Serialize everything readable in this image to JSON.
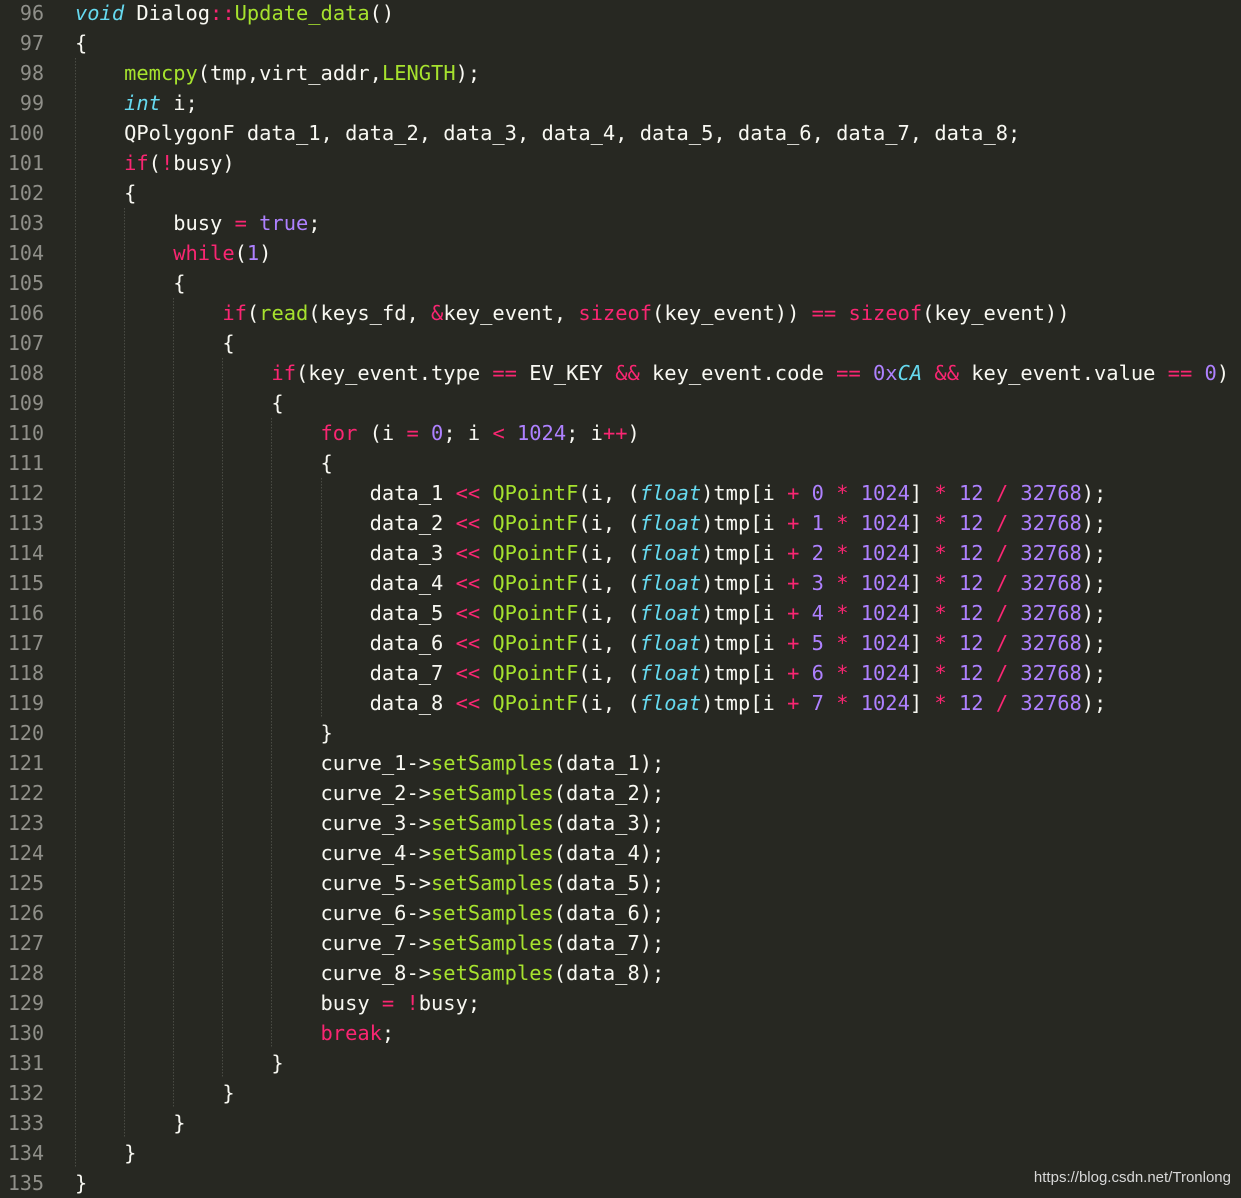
{
  "colors": {
    "background": "#272822",
    "line_number": "#90908a",
    "plain": "#f8f8f2",
    "keyword": "#f92672",
    "function": "#a6e22e",
    "type": "#66d9ef",
    "number": "#ae81ff",
    "indent_guide": "#4a4b44"
  },
  "watermark": "https://blog.csdn.net/Tronlong",
  "lines": [
    {
      "n": "96",
      "tokens": [
        [
          "ty",
          "void"
        ],
        [
          "plain",
          " Dialog"
        ],
        [
          "op",
          "::"
        ],
        [
          "fn",
          "Update_data"
        ],
        [
          "plain",
          "()"
        ]
      ]
    },
    {
      "n": "97",
      "tokens": [
        [
          "plain",
          "{"
        ]
      ]
    },
    {
      "n": "98",
      "tokens": [
        [
          "plain",
          "    "
        ],
        [
          "fn",
          "memcpy"
        ],
        [
          "plain",
          "(tmp,virt_addr,"
        ],
        [
          "fn",
          "LENGTH"
        ],
        [
          "plain",
          ");"
        ]
      ]
    },
    {
      "n": "99",
      "tokens": [
        [
          "plain",
          "    "
        ],
        [
          "ty",
          "int"
        ],
        [
          "plain",
          " i;"
        ]
      ]
    },
    {
      "n": "100",
      "tokens": [
        [
          "plain",
          "    QPolygonF data_1, data_2, data_3, data_4, data_5, data_6, data_7, data_8;"
        ]
      ]
    },
    {
      "n": "101",
      "tokens": [
        [
          "plain",
          "    "
        ],
        [
          "kw",
          "if"
        ],
        [
          "plain",
          "("
        ],
        [
          "op",
          "!"
        ],
        [
          "plain",
          "busy)"
        ]
      ]
    },
    {
      "n": "102",
      "tokens": [
        [
          "plain",
          "    {"
        ]
      ]
    },
    {
      "n": "103",
      "tokens": [
        [
          "plain",
          "        busy "
        ],
        [
          "op",
          "="
        ],
        [
          "plain",
          " "
        ],
        [
          "num",
          "true"
        ],
        [
          "plain",
          ";"
        ]
      ]
    },
    {
      "n": "104",
      "tokens": [
        [
          "plain",
          "        "
        ],
        [
          "kw",
          "while"
        ],
        [
          "plain",
          "("
        ],
        [
          "num",
          "1"
        ],
        [
          "plain",
          ")"
        ]
      ]
    },
    {
      "n": "105",
      "tokens": [
        [
          "plain",
          "        {"
        ]
      ]
    },
    {
      "n": "106",
      "tokens": [
        [
          "plain",
          "            "
        ],
        [
          "kw",
          "if"
        ],
        [
          "plain",
          "("
        ],
        [
          "fn",
          "read"
        ],
        [
          "plain",
          "(keys_fd, "
        ],
        [
          "op",
          "&"
        ],
        [
          "plain",
          "key_event, "
        ],
        [
          "kw",
          "sizeof"
        ],
        [
          "plain",
          "(key_event)) "
        ],
        [
          "op",
          "=="
        ],
        [
          "plain",
          " "
        ],
        [
          "kw",
          "sizeof"
        ],
        [
          "plain",
          "(key_event))"
        ]
      ]
    },
    {
      "n": "107",
      "tokens": [
        [
          "plain",
          "            {"
        ]
      ]
    },
    {
      "n": "108",
      "tokens": [
        [
          "plain",
          "                "
        ],
        [
          "kw",
          "if"
        ],
        [
          "plain",
          "(key_event.type "
        ],
        [
          "op",
          "=="
        ],
        [
          "plain",
          " EV_KEY "
        ],
        [
          "op",
          "&&"
        ],
        [
          "plain",
          " key_event.code "
        ],
        [
          "op",
          "=="
        ],
        [
          "plain",
          " "
        ],
        [
          "num",
          "0x"
        ],
        [
          "ty",
          "CA"
        ],
        [
          "plain",
          " "
        ],
        [
          "op",
          "&&"
        ],
        [
          "plain",
          " key_event.value "
        ],
        [
          "op",
          "=="
        ],
        [
          "plain",
          " "
        ],
        [
          "num",
          "0"
        ],
        [
          "plain",
          ")"
        ]
      ]
    },
    {
      "n": "109",
      "tokens": [
        [
          "plain",
          "                {"
        ]
      ]
    },
    {
      "n": "110",
      "tokens": [
        [
          "plain",
          "                    "
        ],
        [
          "kw",
          "for"
        ],
        [
          "plain",
          " (i "
        ],
        [
          "op",
          "="
        ],
        [
          "plain",
          " "
        ],
        [
          "num",
          "0"
        ],
        [
          "plain",
          "; i "
        ],
        [
          "op",
          "<"
        ],
        [
          "plain",
          " "
        ],
        [
          "num",
          "1024"
        ],
        [
          "plain",
          "; i"
        ],
        [
          "op",
          "++"
        ],
        [
          "plain",
          ")"
        ]
      ]
    },
    {
      "n": "111",
      "tokens": [
        [
          "plain",
          "                    {"
        ]
      ]
    },
    {
      "n": "112",
      "tokens": [
        [
          "plain",
          "                        data_1 "
        ],
        [
          "op",
          "<<"
        ],
        [
          "plain",
          " "
        ],
        [
          "fn",
          "QPointF"
        ],
        [
          "plain",
          "(i, ("
        ],
        [
          "ty",
          "float"
        ],
        [
          "plain",
          ")tmp[i "
        ],
        [
          "op",
          "+"
        ],
        [
          "plain",
          " "
        ],
        [
          "num",
          "0"
        ],
        [
          "plain",
          " "
        ],
        [
          "op",
          "*"
        ],
        [
          "plain",
          " "
        ],
        [
          "num",
          "1024"
        ],
        [
          "plain",
          "] "
        ],
        [
          "op",
          "*"
        ],
        [
          "plain",
          " "
        ],
        [
          "num",
          "12"
        ],
        [
          "plain",
          " "
        ],
        [
          "op",
          "/"
        ],
        [
          "plain",
          " "
        ],
        [
          "num",
          "32768"
        ],
        [
          "plain",
          ");"
        ]
      ]
    },
    {
      "n": "113",
      "tokens": [
        [
          "plain",
          "                        data_2 "
        ],
        [
          "op",
          "<<"
        ],
        [
          "plain",
          " "
        ],
        [
          "fn",
          "QPointF"
        ],
        [
          "plain",
          "(i, ("
        ],
        [
          "ty",
          "float"
        ],
        [
          "plain",
          ")tmp[i "
        ],
        [
          "op",
          "+"
        ],
        [
          "plain",
          " "
        ],
        [
          "num",
          "1"
        ],
        [
          "plain",
          " "
        ],
        [
          "op",
          "*"
        ],
        [
          "plain",
          " "
        ],
        [
          "num",
          "1024"
        ],
        [
          "plain",
          "] "
        ],
        [
          "op",
          "*"
        ],
        [
          "plain",
          " "
        ],
        [
          "num",
          "12"
        ],
        [
          "plain",
          " "
        ],
        [
          "op",
          "/"
        ],
        [
          "plain",
          " "
        ],
        [
          "num",
          "32768"
        ],
        [
          "plain",
          ");"
        ]
      ]
    },
    {
      "n": "114",
      "tokens": [
        [
          "plain",
          "                        data_3 "
        ],
        [
          "op",
          "<<"
        ],
        [
          "plain",
          " "
        ],
        [
          "fn",
          "QPointF"
        ],
        [
          "plain",
          "(i, ("
        ],
        [
          "ty",
          "float"
        ],
        [
          "plain",
          ")tmp[i "
        ],
        [
          "op",
          "+"
        ],
        [
          "plain",
          " "
        ],
        [
          "num",
          "2"
        ],
        [
          "plain",
          " "
        ],
        [
          "op",
          "*"
        ],
        [
          "plain",
          " "
        ],
        [
          "num",
          "1024"
        ],
        [
          "plain",
          "] "
        ],
        [
          "op",
          "*"
        ],
        [
          "plain",
          " "
        ],
        [
          "num",
          "12"
        ],
        [
          "plain",
          " "
        ],
        [
          "op",
          "/"
        ],
        [
          "plain",
          " "
        ],
        [
          "num",
          "32768"
        ],
        [
          "plain",
          ");"
        ]
      ]
    },
    {
      "n": "115",
      "tokens": [
        [
          "plain",
          "                        data_4 "
        ],
        [
          "op",
          "<<"
        ],
        [
          "plain",
          " "
        ],
        [
          "fn",
          "QPointF"
        ],
        [
          "plain",
          "(i, ("
        ],
        [
          "ty",
          "float"
        ],
        [
          "plain",
          ")tmp[i "
        ],
        [
          "op",
          "+"
        ],
        [
          "plain",
          " "
        ],
        [
          "num",
          "3"
        ],
        [
          "plain",
          " "
        ],
        [
          "op",
          "*"
        ],
        [
          "plain",
          " "
        ],
        [
          "num",
          "1024"
        ],
        [
          "plain",
          "] "
        ],
        [
          "op",
          "*"
        ],
        [
          "plain",
          " "
        ],
        [
          "num",
          "12"
        ],
        [
          "plain",
          " "
        ],
        [
          "op",
          "/"
        ],
        [
          "plain",
          " "
        ],
        [
          "num",
          "32768"
        ],
        [
          "plain",
          ");"
        ]
      ]
    },
    {
      "n": "116",
      "tokens": [
        [
          "plain",
          "                        data_5 "
        ],
        [
          "op",
          "<<"
        ],
        [
          "plain",
          " "
        ],
        [
          "fn",
          "QPointF"
        ],
        [
          "plain",
          "(i, ("
        ],
        [
          "ty",
          "float"
        ],
        [
          "plain",
          ")tmp[i "
        ],
        [
          "op",
          "+"
        ],
        [
          "plain",
          " "
        ],
        [
          "num",
          "4"
        ],
        [
          "plain",
          " "
        ],
        [
          "op",
          "*"
        ],
        [
          "plain",
          " "
        ],
        [
          "num",
          "1024"
        ],
        [
          "plain",
          "] "
        ],
        [
          "op",
          "*"
        ],
        [
          "plain",
          " "
        ],
        [
          "num",
          "12"
        ],
        [
          "plain",
          " "
        ],
        [
          "op",
          "/"
        ],
        [
          "plain",
          " "
        ],
        [
          "num",
          "32768"
        ],
        [
          "plain",
          ");"
        ]
      ]
    },
    {
      "n": "117",
      "tokens": [
        [
          "plain",
          "                        data_6 "
        ],
        [
          "op",
          "<<"
        ],
        [
          "plain",
          " "
        ],
        [
          "fn",
          "QPointF"
        ],
        [
          "plain",
          "(i, ("
        ],
        [
          "ty",
          "float"
        ],
        [
          "plain",
          ")tmp[i "
        ],
        [
          "op",
          "+"
        ],
        [
          "plain",
          " "
        ],
        [
          "num",
          "5"
        ],
        [
          "plain",
          " "
        ],
        [
          "op",
          "*"
        ],
        [
          "plain",
          " "
        ],
        [
          "num",
          "1024"
        ],
        [
          "plain",
          "] "
        ],
        [
          "op",
          "*"
        ],
        [
          "plain",
          " "
        ],
        [
          "num",
          "12"
        ],
        [
          "plain",
          " "
        ],
        [
          "op",
          "/"
        ],
        [
          "plain",
          " "
        ],
        [
          "num",
          "32768"
        ],
        [
          "plain",
          ");"
        ]
      ]
    },
    {
      "n": "118",
      "tokens": [
        [
          "plain",
          "                        data_7 "
        ],
        [
          "op",
          "<<"
        ],
        [
          "plain",
          " "
        ],
        [
          "fn",
          "QPointF"
        ],
        [
          "plain",
          "(i, ("
        ],
        [
          "ty",
          "float"
        ],
        [
          "plain",
          ")tmp[i "
        ],
        [
          "op",
          "+"
        ],
        [
          "plain",
          " "
        ],
        [
          "num",
          "6"
        ],
        [
          "plain",
          " "
        ],
        [
          "op",
          "*"
        ],
        [
          "plain",
          " "
        ],
        [
          "num",
          "1024"
        ],
        [
          "plain",
          "] "
        ],
        [
          "op",
          "*"
        ],
        [
          "plain",
          " "
        ],
        [
          "num",
          "12"
        ],
        [
          "plain",
          " "
        ],
        [
          "op",
          "/"
        ],
        [
          "plain",
          " "
        ],
        [
          "num",
          "32768"
        ],
        [
          "plain",
          ");"
        ]
      ]
    },
    {
      "n": "119",
      "tokens": [
        [
          "plain",
          "                        data_8 "
        ],
        [
          "op",
          "<<"
        ],
        [
          "plain",
          " "
        ],
        [
          "fn",
          "QPointF"
        ],
        [
          "plain",
          "(i, ("
        ],
        [
          "ty",
          "float"
        ],
        [
          "plain",
          ")tmp[i "
        ],
        [
          "op",
          "+"
        ],
        [
          "plain",
          " "
        ],
        [
          "num",
          "7"
        ],
        [
          "plain",
          " "
        ],
        [
          "op",
          "*"
        ],
        [
          "plain",
          " "
        ],
        [
          "num",
          "1024"
        ],
        [
          "plain",
          "] "
        ],
        [
          "op",
          "*"
        ],
        [
          "plain",
          " "
        ],
        [
          "num",
          "12"
        ],
        [
          "plain",
          " "
        ],
        [
          "op",
          "/"
        ],
        [
          "plain",
          " "
        ],
        [
          "num",
          "32768"
        ],
        [
          "plain",
          ");"
        ]
      ]
    },
    {
      "n": "120",
      "tokens": [
        [
          "plain",
          "                    }"
        ]
      ]
    },
    {
      "n": "121",
      "tokens": [
        [
          "plain",
          "                    curve_1->"
        ],
        [
          "fn",
          "setSamples"
        ],
        [
          "plain",
          "(data_1);"
        ]
      ]
    },
    {
      "n": "122",
      "tokens": [
        [
          "plain",
          "                    curve_2->"
        ],
        [
          "fn",
          "setSamples"
        ],
        [
          "plain",
          "(data_2);"
        ]
      ]
    },
    {
      "n": "123",
      "tokens": [
        [
          "plain",
          "                    curve_3->"
        ],
        [
          "fn",
          "setSamples"
        ],
        [
          "plain",
          "(data_3);"
        ]
      ]
    },
    {
      "n": "124",
      "tokens": [
        [
          "plain",
          "                    curve_4->"
        ],
        [
          "fn",
          "setSamples"
        ],
        [
          "plain",
          "(data_4);"
        ]
      ]
    },
    {
      "n": "125",
      "tokens": [
        [
          "plain",
          "                    curve_5->"
        ],
        [
          "fn",
          "setSamples"
        ],
        [
          "plain",
          "(data_5);"
        ]
      ]
    },
    {
      "n": "126",
      "tokens": [
        [
          "plain",
          "                    curve_6->"
        ],
        [
          "fn",
          "setSamples"
        ],
        [
          "plain",
          "(data_6);"
        ]
      ]
    },
    {
      "n": "127",
      "tokens": [
        [
          "plain",
          "                    curve_7->"
        ],
        [
          "fn",
          "setSamples"
        ],
        [
          "plain",
          "(data_7);"
        ]
      ]
    },
    {
      "n": "128",
      "tokens": [
        [
          "plain",
          "                    curve_8->"
        ],
        [
          "fn",
          "setSamples"
        ],
        [
          "plain",
          "(data_8);"
        ]
      ]
    },
    {
      "n": "129",
      "tokens": [
        [
          "plain",
          "                    busy "
        ],
        [
          "op",
          "="
        ],
        [
          "plain",
          " "
        ],
        [
          "op",
          "!"
        ],
        [
          "plain",
          "busy;"
        ]
      ]
    },
    {
      "n": "130",
      "tokens": [
        [
          "plain",
          "                    "
        ],
        [
          "kw",
          "break"
        ],
        [
          "plain",
          ";"
        ]
      ]
    },
    {
      "n": "131",
      "tokens": [
        [
          "plain",
          "                }"
        ]
      ]
    },
    {
      "n": "132",
      "tokens": [
        [
          "plain",
          "            }"
        ]
      ]
    },
    {
      "n": "133",
      "tokens": [
        [
          "plain",
          "        }"
        ]
      ]
    },
    {
      "n": "134",
      "tokens": [
        [
          "plain",
          "    }"
        ]
      ]
    },
    {
      "n": "135",
      "tokens": [
        [
          "plain",
          "}"
        ]
      ]
    }
  ]
}
